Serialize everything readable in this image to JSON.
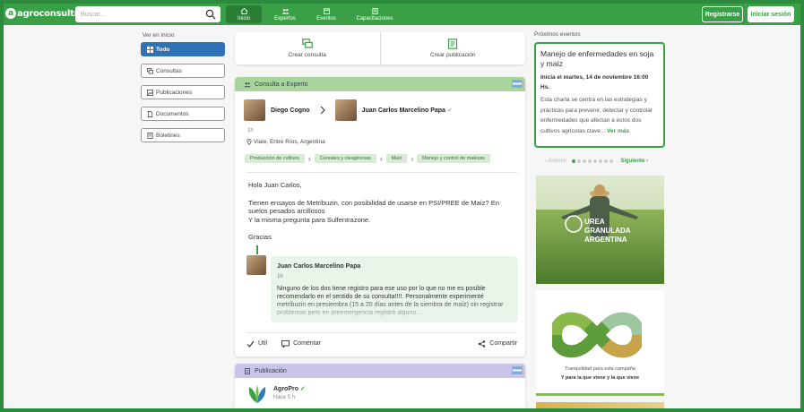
{
  "brand": {
    "name": "agroconsultas",
    "mark": "a"
  },
  "search": {
    "placeholder": "Buscar..."
  },
  "nav": [
    {
      "label": "Inicio",
      "icon": "home-icon"
    },
    {
      "label": "Expertos",
      "icon": "people-icon"
    },
    {
      "label": "Eventos",
      "icon": "calendar-icon"
    },
    {
      "label": "Capacitaciones",
      "icon": "book-icon"
    }
  ],
  "header": {
    "register": "Registrarse",
    "login": "Iniciar sesión"
  },
  "filters": {
    "title": "Ver en inicio",
    "items": [
      "Todo",
      "Consultas",
      "Publicaciones",
      "Documentos",
      "Boletines"
    ]
  },
  "create": {
    "consult": "Crear consulta",
    "publication": "Crear publicación"
  },
  "post": {
    "type": "Consulta a Experto",
    "author": "Diego Cogno",
    "expert": "Juan Carlos Marcelino Papa",
    "time": "1h",
    "location": "Viale, Entre Ríos, Argentina",
    "tags": [
      "Producción de cultivos",
      "Cereales y oleaginosas",
      "Maíz",
      "Manejo y control de malezas"
    ],
    "body": [
      "Hola Juan Carlos,",
      "Tienen ensayos de Metribuzin, con posibilidad de usarse en PSI/PREE de Maíz? En suelos pesados arcillosos",
      "Y la misma pregunta para Sulfentrazone.",
      "Gracias"
    ],
    "reply": {
      "author": "Juan Carlos Marcelino Papa",
      "time": "1h",
      "text": "Ninguno de los dos tiene registro para ese uso por lo que no me es posible recomendarlo en el sentido de su consulta!!!!. Personalmente experimenté metribuzin en presiembra (15 a 20 días antes de la siembra de maíz) sin registrar problemas pero en preemergencia registré alguno..."
    },
    "actions": {
      "useful": "Útil",
      "comment": "Comentar",
      "share": "Compartir"
    }
  },
  "post2": {
    "type": "Publicación",
    "author": "AgroPro",
    "time": "Hace 5 h"
  },
  "events": {
    "title": "Próximos eventos",
    "event": {
      "title": "Manejo de enfermedades en soja y maíz",
      "date": "Inicia el martes, 14 de noviembre 16:00 Hs.",
      "desc": "Esta charla se centra en las estrategias y prácticas para prevenir, detectar y controlar enfermedades que afectan a estos dos cultivos agrícolas clave...",
      "more": "Ver más"
    },
    "prev": "Anterior",
    "next": "Siguiente",
    "dots": 8
  },
  "ads": {
    "ad1": "UREA GRANULADA ARGENTINA",
    "ad2_line1": "Tranquilidad para esta campaña",
    "ad2_line2": "Y para la que viene y la que viene"
  },
  "colors": {
    "brand": "#3aa047",
    "active_filter": "#3072b6",
    "consulta_header": "#a9d49d",
    "publicacion_header": "#c9c5e8"
  }
}
